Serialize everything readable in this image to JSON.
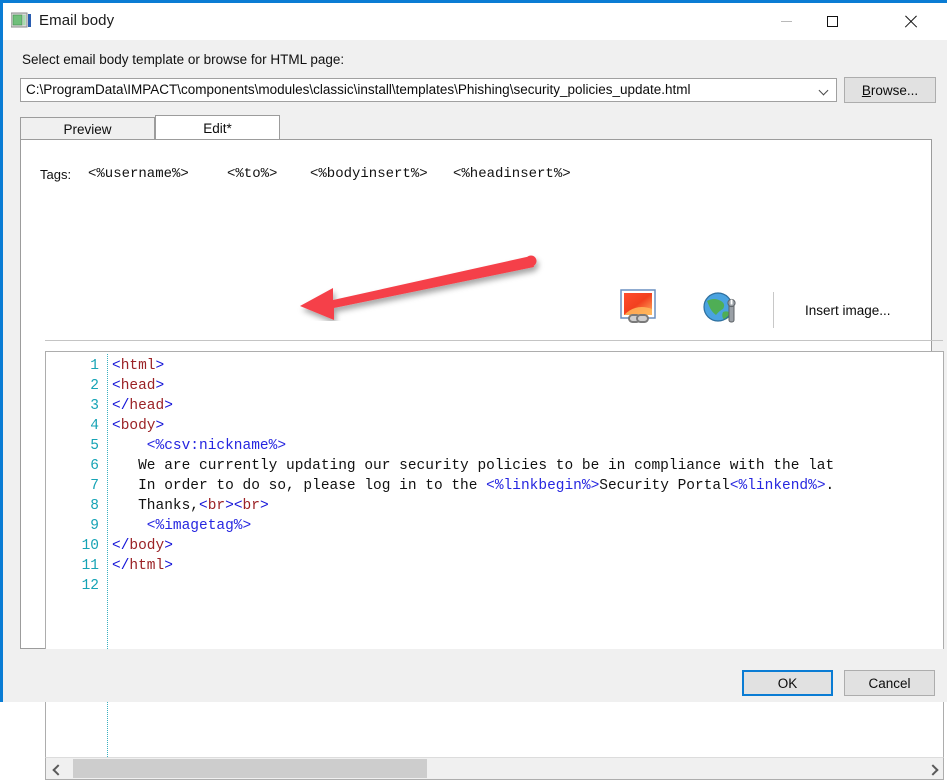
{
  "window": {
    "title": "Email body",
    "icon": "image-picture-icon",
    "minimize_label": "Minimize",
    "maximize_label": "Maximize",
    "close_label": "Close"
  },
  "combo_section": {
    "label": "Select email body template or browse for HTML page:",
    "path_value": "C:\\ProgramData\\IMPACT\\components\\modules\\classic\\install\\templates\\Phishing\\security_policies_update.html",
    "dropdown_icon": "chevron-down-icon",
    "browse_button": {
      "accel": "B",
      "rest": "rowse..."
    }
  },
  "tabs": [
    {
      "label": "Preview",
      "active": false
    },
    {
      "label": "Edit*",
      "active": true
    }
  ],
  "toolbar": {
    "tags_label": "Tags:",
    "tags": [
      "<%username%>",
      "<%to%>",
      "<%bodyinsert%>",
      "<%headinsert%>"
    ],
    "image_link_icon": "insert-image-link-icon",
    "globe_wrench_icon": "globe-settings-icon",
    "insert_image": {
      "pre": "Insert ima",
      "accel": "g",
      "post": "e..."
    }
  },
  "editor": {
    "line_numbers": [
      "1",
      "2",
      "3",
      "4",
      "5",
      "6",
      "7",
      "8",
      "9",
      "10",
      "11",
      "12"
    ],
    "lines": [
      {
        "n": 1,
        "indent": 0,
        "segments": [
          {
            "t": "<",
            "c": "br-ang"
          },
          {
            "t": "html",
            "c": "tagname"
          },
          {
            "t": ">",
            "c": "br-ang"
          }
        ]
      },
      {
        "n": 2,
        "indent": 0,
        "segments": [
          {
            "t": "<",
            "c": "br-ang"
          },
          {
            "t": "head",
            "c": "tagname"
          },
          {
            "t": ">",
            "c": "br-ang"
          }
        ]
      },
      {
        "n": 3,
        "indent": 0,
        "segments": [
          {
            "t": "</",
            "c": "br-ang"
          },
          {
            "t": "head",
            "c": "tagname"
          },
          {
            "t": ">",
            "c": "br-ang"
          }
        ]
      },
      {
        "n": 4,
        "indent": 0,
        "segments": [
          {
            "t": "<",
            "c": "br-ang"
          },
          {
            "t": "body",
            "c": "tagname"
          },
          {
            "t": ">",
            "c": "br-ang"
          }
        ]
      },
      {
        "n": 5,
        "indent": 4,
        "segments": [
          {
            "t": "<%csv:nickname%>",
            "c": "macro"
          }
        ]
      },
      {
        "n": 6,
        "indent": 3,
        "segments": [
          {
            "t": "We are currently updating our security policies to be in compliance with the lat",
            "c": "plain"
          }
        ]
      },
      {
        "n": 7,
        "indent": 3,
        "segments": [
          {
            "t": "In order to do so, please log in to the ",
            "c": "plain"
          },
          {
            "t": "<%linkbegin%>",
            "c": "macro"
          },
          {
            "t": "Security Portal",
            "c": "plain"
          },
          {
            "t": "<%linkend%>",
            "c": "macro"
          },
          {
            "t": ".",
            "c": "plain"
          }
        ]
      },
      {
        "n": 8,
        "indent": 3,
        "segments": [
          {
            "t": "Thanks,",
            "c": "plain"
          },
          {
            "t": "<",
            "c": "br-ang"
          },
          {
            "t": "br",
            "c": "tagname"
          },
          {
            "t": ">",
            "c": "br-ang"
          },
          {
            "t": "<",
            "c": "br-ang"
          },
          {
            "t": "br",
            "c": "tagname"
          },
          {
            "t": ">",
            "c": "br-ang"
          }
        ]
      },
      {
        "n": 9,
        "indent": 4,
        "segments": [
          {
            "t": "<%imagetag%>",
            "c": "macro"
          }
        ]
      },
      {
        "n": 10,
        "indent": 0,
        "segments": [
          {
            "t": "</",
            "c": "br-ang"
          },
          {
            "t": "body",
            "c": "tagname"
          },
          {
            "t": ">",
            "c": "br-ang"
          }
        ]
      },
      {
        "n": 11,
        "indent": 0,
        "segments": [
          {
            "t": "</",
            "c": "br-ang"
          },
          {
            "t": "html",
            "c": "tagname"
          },
          {
            "t": ">",
            "c": "br-ang"
          }
        ]
      },
      {
        "n": 12,
        "indent": 0,
        "segments": []
      }
    ],
    "caret_line": 5,
    "scrollbar": {
      "left_arrow_icon": "chevron-left-icon",
      "right_arrow_icon": "chevron-right-icon"
    }
  },
  "dialog_buttons": {
    "ok": "OK",
    "cancel": "Cancel"
  },
  "annotation": {
    "arrow_color": "#f5404a",
    "points_to": "caret-end-of-csv-nickname-tag"
  },
  "colors": {
    "accent": "#0a7cd4",
    "dialog_bg": "#f0f0f0",
    "editor_bg": "#ffffff",
    "line_number": "#16a3b5",
    "tag_name": "#9b2226",
    "angle_bracket": "#1414d8",
    "macro": "#2626e0",
    "annotation_red": "#f5404a"
  }
}
